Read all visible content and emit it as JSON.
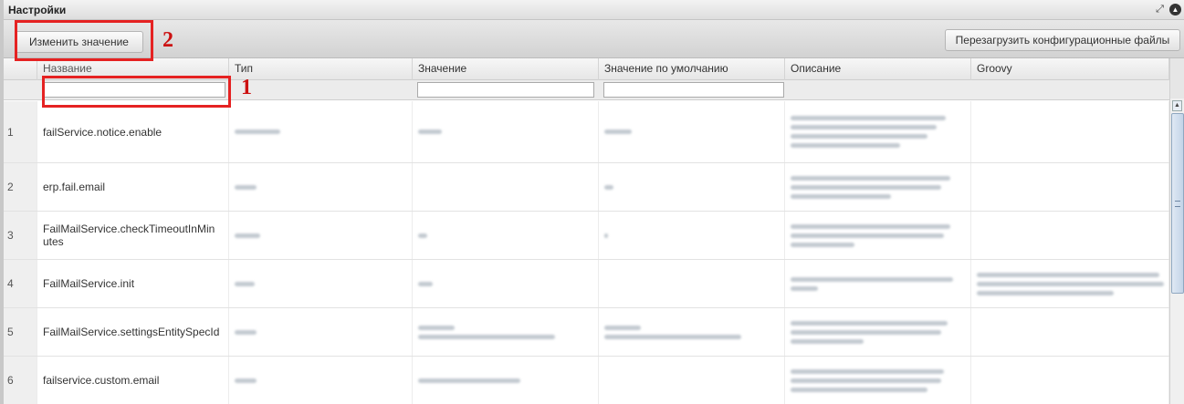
{
  "panel": {
    "title": "Настройки",
    "resize_glyph": "⤢",
    "collapse_glyph": "▲"
  },
  "toolbar": {
    "edit_label": "Изменить значение",
    "reload_label": "Перезагрузить конфигурационные файлы"
  },
  "annotations": {
    "label_1": "1",
    "label_2": "2",
    "color": "#e52222"
  },
  "columns": [
    "Название",
    "Тип",
    "Значение",
    "Значение по умолчанию",
    "Описание",
    "Groovy"
  ],
  "rows": [
    {
      "num": "1",
      "name": "failService.notice.enable"
    },
    {
      "num": "2",
      "name": "erp.fail.email"
    },
    {
      "num": "3",
      "name": "FailMailService.checkTimeoutInMin utes"
    },
    {
      "num": "4",
      "name": "FailMailService.init"
    },
    {
      "num": "5",
      "name": "FailMailService.settingsEntitySpecId"
    },
    {
      "num": "6",
      "name": "failservice.custom.email"
    }
  ]
}
